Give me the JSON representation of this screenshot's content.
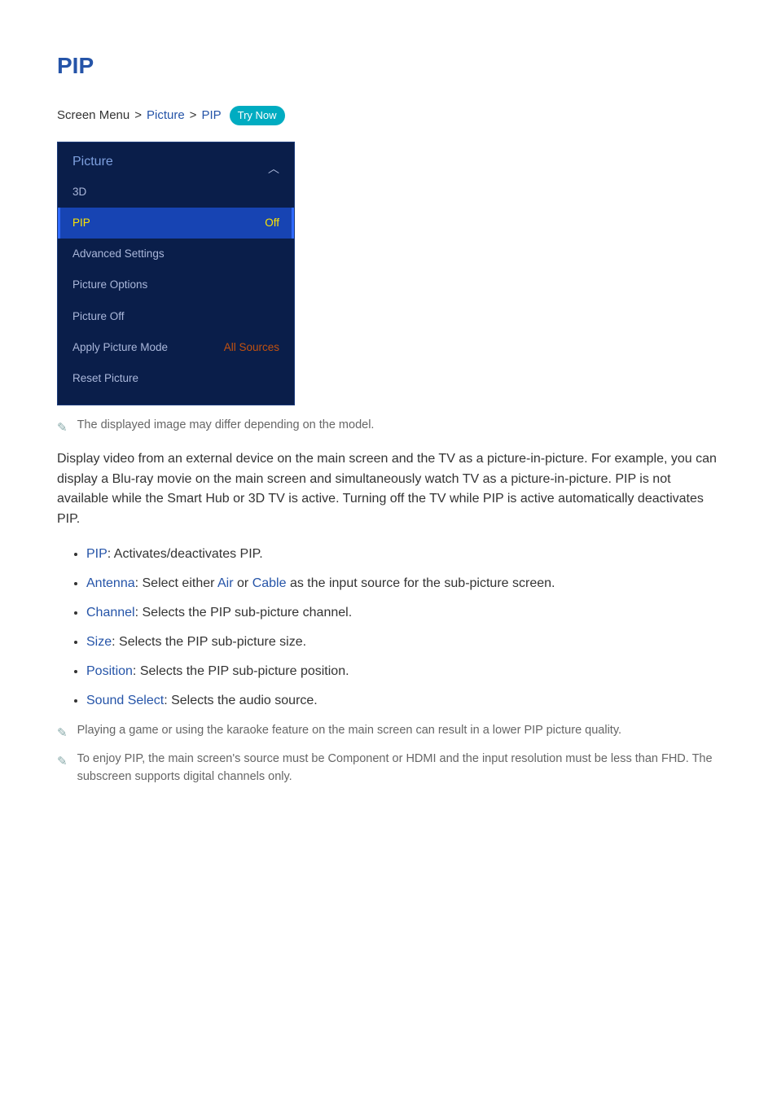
{
  "title": "PIP",
  "breadcrumb": {
    "root": "Screen Menu",
    "part1": "Picture",
    "part2": "PIP",
    "trynow": "Try Now"
  },
  "menu": {
    "header": "Picture",
    "items": [
      {
        "label": "3D",
        "value": ""
      },
      {
        "label": "PIP",
        "value": "Off",
        "highlight": true
      },
      {
        "label": "Advanced Settings",
        "value": ""
      },
      {
        "label": "Picture Options",
        "value": ""
      },
      {
        "label": "Picture Off",
        "value": ""
      },
      {
        "label": "Apply Picture Mode",
        "value": "All Sources"
      },
      {
        "label": "Reset Picture",
        "value": ""
      }
    ]
  },
  "note_top": "The displayed image may differ depending on the model.",
  "intro": "Display video from an external device on the main screen and the TV as a picture-in-picture. For example, you can display a Blu-ray movie on the main screen and simultaneously watch TV as a picture-in-picture. PIP is not available while the Smart Hub or 3D TV is active. Turning off the TV while PIP is active automatically deactivates PIP.",
  "bullets": [
    {
      "label": "PIP",
      "desc": ": Activates/deactivates PIP."
    },
    {
      "label": "Antenna",
      "desc_pre": ": Select either ",
      "opt1": "Air",
      "mid": " or ",
      "opt2": "Cable",
      "desc_post": " as the input source for the sub-picture screen."
    },
    {
      "label": "Channel",
      "desc": ": Selects the PIP sub-picture channel."
    },
    {
      "label": "Size",
      "desc": ": Selects the PIP sub-picture size."
    },
    {
      "label": "Position",
      "desc": ": Selects the PIP sub-picture position."
    },
    {
      "label": "Sound Select",
      "desc": ": Selects the audio source."
    }
  ],
  "note_bottom1": "Playing a game or using the karaoke feature on the main screen can result in a lower PIP picture quality.",
  "note_bottom2": "To enjoy PIP, the main screen's source must be Component or HDMI and the input resolution must be less than FHD. The subscreen supports digital channels only."
}
